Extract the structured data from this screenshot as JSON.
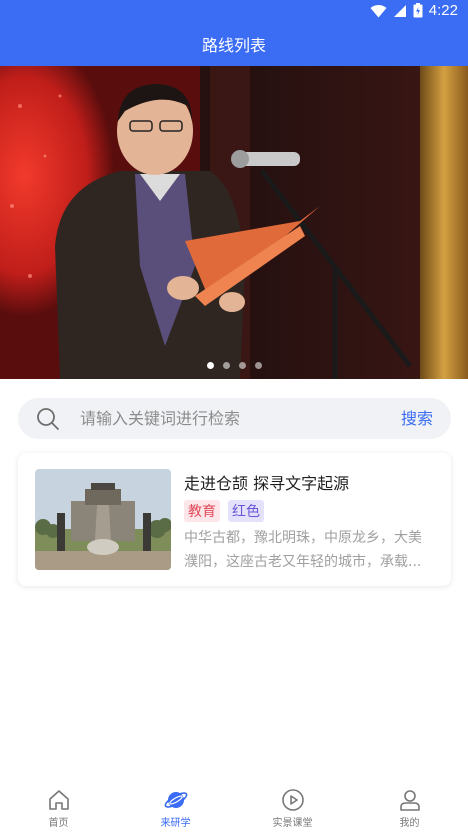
{
  "status_bar": {
    "time": "4:22"
  },
  "header": {
    "title": "路线列表"
  },
  "banner": {
    "total_slides": 4,
    "active_index": 0
  },
  "search": {
    "placeholder": "请输入关键词进行检索",
    "button_label": "搜索"
  },
  "route_card": {
    "title": "走进仓颉 探寻文字起源",
    "tags": [
      "教育",
      "红色"
    ],
    "description_lines": [
      "中华古都，豫北明珠，中原龙乡，大美",
      "濮阳，这座古老又年轻的城市，承载..."
    ]
  },
  "bottom_nav": {
    "items": [
      {
        "label": "首页",
        "icon": "home-icon"
      },
      {
        "label": "来研学",
        "icon": "planet-icon"
      },
      {
        "label": "实景课堂",
        "icon": "play-circle-icon"
      },
      {
        "label": "我的",
        "icon": "user-icon"
      }
    ],
    "active_index": 1
  },
  "colors": {
    "primary": "#3a6cf4",
    "tag_red": "#e24a5a",
    "tag_purple": "#6a55d8"
  }
}
